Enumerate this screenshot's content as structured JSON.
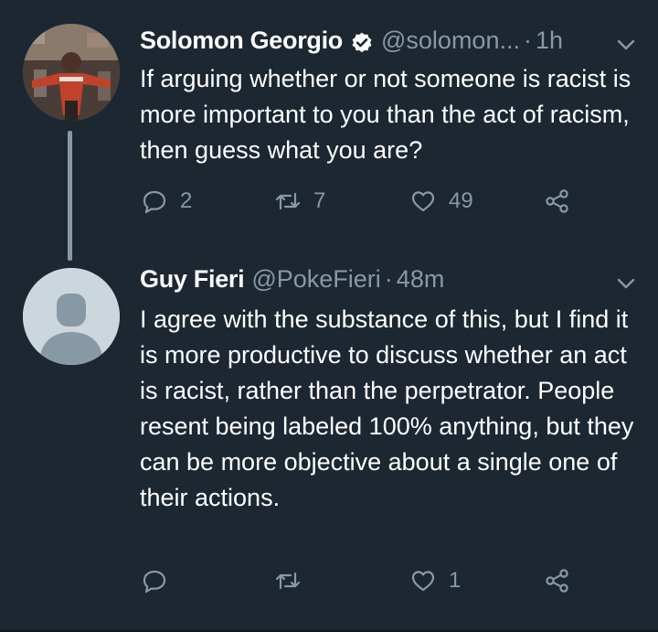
{
  "tweets": [
    {
      "name": "Solomon Georgio",
      "verified": true,
      "handle": "@solomon...",
      "separator": "·",
      "time": "1h",
      "text": "If arguing whether or not someone is racist is more important to you than the act of racism, then guess what you are?",
      "reply_count": "2",
      "retweet_count": "7",
      "like_count": "49",
      "avatar": "user-photo"
    },
    {
      "name": "Guy Fieri",
      "handle": "@PokeFieri",
      "separator": "·",
      "time": "48m",
      "text": "I agree with the substance of this, but I find it is more productive to discuss whether an act is racist, rather than the perpetrator. People resent being labeled 100% anything, but they can be more objective about a single one of their actions.",
      "reply_count": "",
      "retweet_count": "",
      "like_count": "1",
      "avatar": "default-avatar"
    }
  ],
  "colors": {
    "background": "#1c2732",
    "text": "#ffffff",
    "muted": "#8899a6",
    "verified": "#ffffff"
  },
  "icons": [
    "verified-badge-icon",
    "chevron-down-icon",
    "reply-icon",
    "retweet-icon",
    "like-icon",
    "share-icon"
  ]
}
